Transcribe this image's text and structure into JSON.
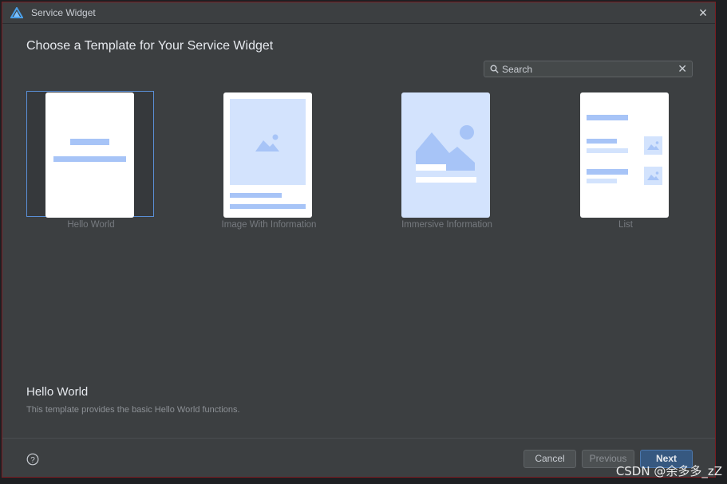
{
  "window": {
    "title": "Service Widget"
  },
  "heading": "Choose a Template for Your Service Widget",
  "search": {
    "placeholder": "Search"
  },
  "templates": [
    {
      "label": "Hello World",
      "selected": true
    },
    {
      "label": "Image With Information",
      "selected": false
    },
    {
      "label": "Immersive Information",
      "selected": false
    },
    {
      "label": "List",
      "selected": false
    }
  ],
  "description": {
    "title": "Hello World",
    "text": "This template provides the basic Hello World functions."
  },
  "buttons": {
    "cancel": "Cancel",
    "previous": "Previous",
    "next": "Next"
  },
  "watermark": "CSDN @余多多_zZ",
  "colors": {
    "accent": "#365880",
    "selection_border": "#5a8fd6",
    "preview_blue": "#a7c4f7",
    "preview_light_blue": "#d3e3fd"
  }
}
